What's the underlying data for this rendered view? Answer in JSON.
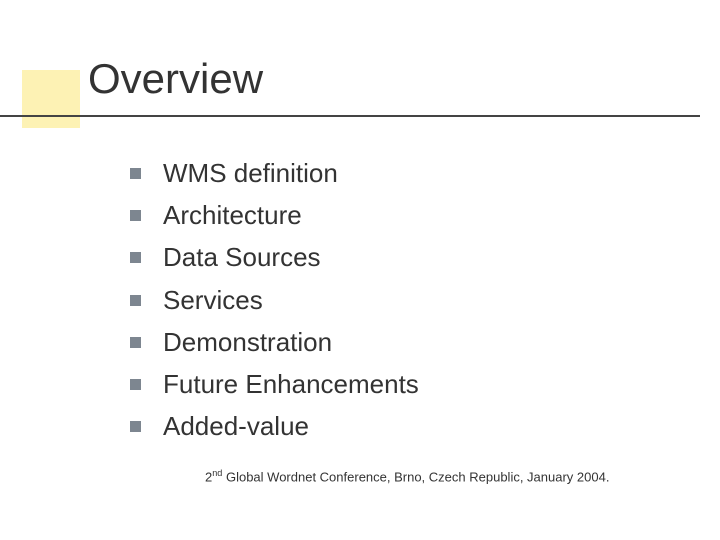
{
  "title": "Overview",
  "bullets": {
    "items": [
      {
        "label": "WMS definition"
      },
      {
        "label": "Architecture"
      },
      {
        "label": "Data Sources"
      },
      {
        "label": "Services"
      },
      {
        "label": "Demonstration"
      },
      {
        "label": "Future Enhancements"
      },
      {
        "label": "Added-value"
      }
    ]
  },
  "footer": {
    "ordinal_num": "2",
    "ordinal_suffix": "nd",
    "rest": " Global Wordnet Conference, Brno, Czech Republic, January 2004."
  }
}
